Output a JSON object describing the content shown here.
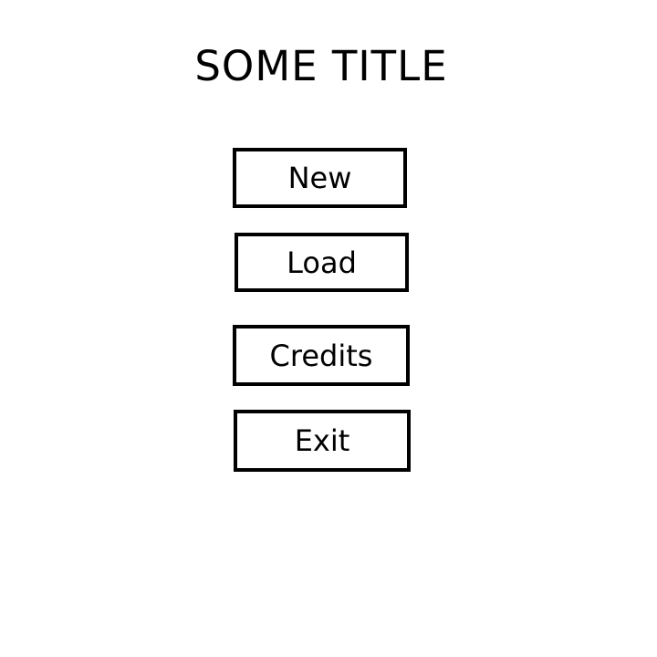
{
  "title": "SOME TITLE",
  "menu": {
    "new_label": "New",
    "load_label": "Load",
    "credits_label": "Credits",
    "exit_label": "Exit"
  },
  "colors": {
    "background": "#ffffff",
    "text": "#000000",
    "border": "#000000"
  }
}
